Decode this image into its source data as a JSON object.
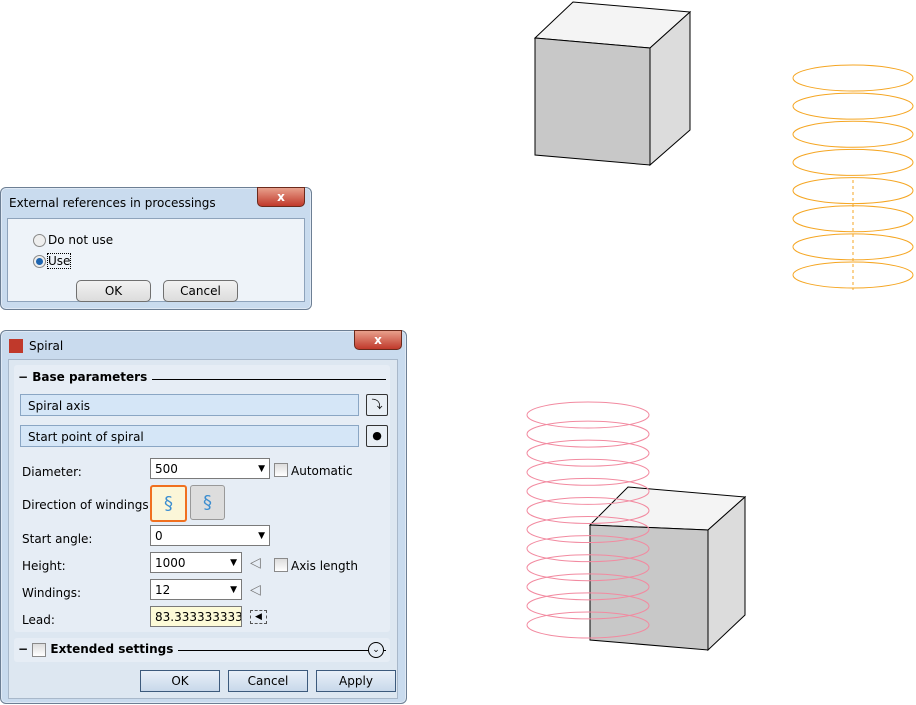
{
  "ext_dialog": {
    "title": "External references in processings",
    "close": "x",
    "options": [
      {
        "label": "Do not use",
        "selected": false
      },
      {
        "label": "Use",
        "selected": true
      }
    ],
    "ok": "OK",
    "cancel": "Cancel"
  },
  "spiral_dialog": {
    "title": "Spiral",
    "close": "x",
    "section": "Base parameters",
    "spiral_axis": "Spiral axis",
    "start_point": "Start point of spiral",
    "diameter_label": "Diameter:",
    "diameter": "500",
    "automatic": "Automatic",
    "direction_label": "Direction of windings:",
    "start_angle_label": "Start angle:",
    "start_angle": "0",
    "height_label": "Height:",
    "height": "1000",
    "axis_length": "Axis length",
    "windings_label": "Windings:",
    "windings": "12",
    "lead_label": "Lead:",
    "lead": "83.3333333333",
    "extended": "Extended settings",
    "ok": "OK",
    "cancel": "Cancel",
    "apply": "Apply"
  },
  "colors": {
    "orange_spiral": "#f5a623",
    "pink_spiral": "#f28aa0",
    "cube_front": "#cfcfcf",
    "cube_side": "#e2e2e2"
  },
  "spirals": {
    "orange_windings": 8,
    "pink_windings": 12
  }
}
